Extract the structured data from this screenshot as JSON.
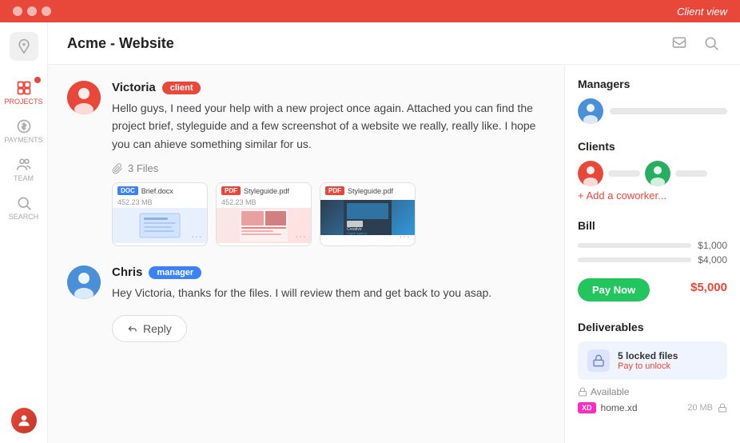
{
  "topbar": {
    "title": "Client view"
  },
  "header": {
    "title": "Acme - Website"
  },
  "sidebar": {
    "items": [
      {
        "label": "PROJECTS",
        "active": true
      },
      {
        "label": "PAYMENTS",
        "active": false
      },
      {
        "label": "TEAM",
        "active": false
      },
      {
        "label": "SEARCH",
        "active": false
      }
    ]
  },
  "messages": [
    {
      "name": "Victoria",
      "badge": "client",
      "text": "Hello guys, I need your help with a new project once again. Attached you can find the project brief, styleguide and a few screenshot of a website we really, really like. I hope you can ahieve something similar for us.",
      "files_label": "3 Files",
      "files": [
        {
          "type": "DOC",
          "name": "Brief.docx",
          "size": "452.23 MB"
        },
        {
          "type": "PDF",
          "name": "Styleguide.pdf",
          "size": "452.23 MB"
        },
        {
          "type": "PDF",
          "name": "Styleguide.pdf",
          "size": ""
        }
      ]
    },
    {
      "name": "Chris",
      "badge": "manager",
      "text": "Hey Victoria, thanks for the files. I will review them and get back to you asap."
    }
  ],
  "reply_button": "Reply",
  "right_panel": {
    "managers_title": "Managers",
    "clients_title": "Clients",
    "add_coworker": "+ Add a coworker...",
    "bill_title": "Bill",
    "bill_rows": [
      {
        "amount": "$1,000"
      },
      {
        "amount": "$4,000"
      }
    ],
    "pay_now": "Pay Now",
    "total": "$5,000",
    "deliverables_title": "Deliverables",
    "locked_files": "5 locked files",
    "pay_to_unlock": "Pay to unlock",
    "available_label": "Available",
    "file": {
      "name": "home.xd",
      "size": "20 MB"
    }
  }
}
